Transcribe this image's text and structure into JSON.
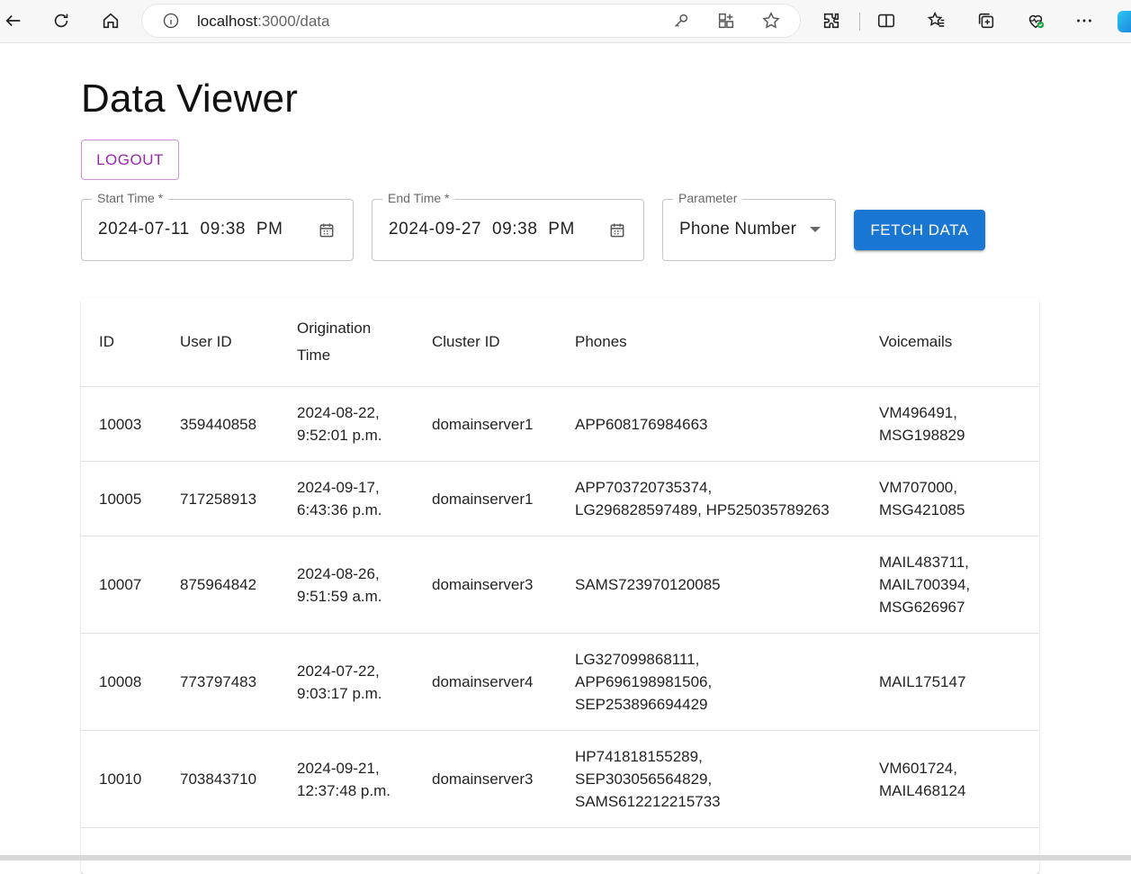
{
  "browser": {
    "url_host": "localhost",
    "url_path": ":3000/data",
    "icons": [
      "back-icon",
      "refresh-icon",
      "home-icon",
      "info-icon",
      "key-icon",
      "app-icon",
      "favorite-star-icon",
      "extensions-icon",
      "split-screen-icon",
      "favorites-icon",
      "collections-icon",
      "browser-essentials-icon",
      "more-icon",
      "edge-logo"
    ]
  },
  "page": {
    "title": "Data Viewer",
    "logout_label": "LOGOUT",
    "start_time": {
      "label": "Start Time *",
      "value": "2024-07-11  09:38  PM"
    },
    "end_time": {
      "label": "End Time *",
      "value": "2024-09-27  09:38  PM"
    },
    "parameter": {
      "label": "Parameter",
      "value": "Phone Number"
    },
    "fetch_label": "FETCH DATA",
    "colors": {
      "primary": "#1976d2",
      "secondary": "#9c27b0"
    }
  },
  "table": {
    "headers": {
      "id": "ID",
      "user_id": "User ID",
      "origination_line1": "Origination",
      "origination_line2": "Time",
      "cluster_id": "Cluster ID",
      "phones": "Phones",
      "voicemails": "Voicemails"
    },
    "rows": [
      {
        "id": "10003",
        "user_id": "359440858",
        "orig_date": "2024-08-22,",
        "orig_time": "9:52:01 p.m.",
        "cluster": "domainserver1",
        "phones": [
          "APP608176984663"
        ],
        "voicemails": [
          "VM496491,",
          "MSG198829"
        ]
      },
      {
        "id": "10005",
        "user_id": "717258913",
        "orig_date": "2024-09-17,",
        "orig_time": "6:43:36 p.m.",
        "cluster": "domainserver1",
        "phones": [
          "APP703720735374,",
          "LG296828597489, HP525035789263"
        ],
        "voicemails": [
          "VM707000,",
          "MSG421085"
        ]
      },
      {
        "id": "10007",
        "user_id": "875964842",
        "orig_date": "2024-08-26,",
        "orig_time": "9:51:59 a.m.",
        "cluster": "domainserver3",
        "phones": [
          "SAMS723970120085"
        ],
        "voicemails": [
          "MAIL483711,",
          "MAIL700394,",
          "MSG626967"
        ]
      },
      {
        "id": "10008",
        "user_id": "773797483",
        "orig_date": "2024-07-22,",
        "orig_time": "9:03:17 p.m.",
        "cluster": "domainserver4",
        "phones": [
          "LG327099868111,",
          "APP696198981506,",
          "SEP253896694429"
        ],
        "voicemails": [
          "MAIL175147"
        ]
      },
      {
        "id": "10010",
        "user_id": "703843710",
        "orig_date": "2024-09-21,",
        "orig_time": "12:37:48 p.m.",
        "cluster": "domainserver3",
        "phones": [
          "HP741818155289,",
          "SEP303056564829,",
          "SAMS612212215733"
        ],
        "voicemails": [
          "VM601724,",
          "MAIL468124"
        ]
      }
    ]
  }
}
